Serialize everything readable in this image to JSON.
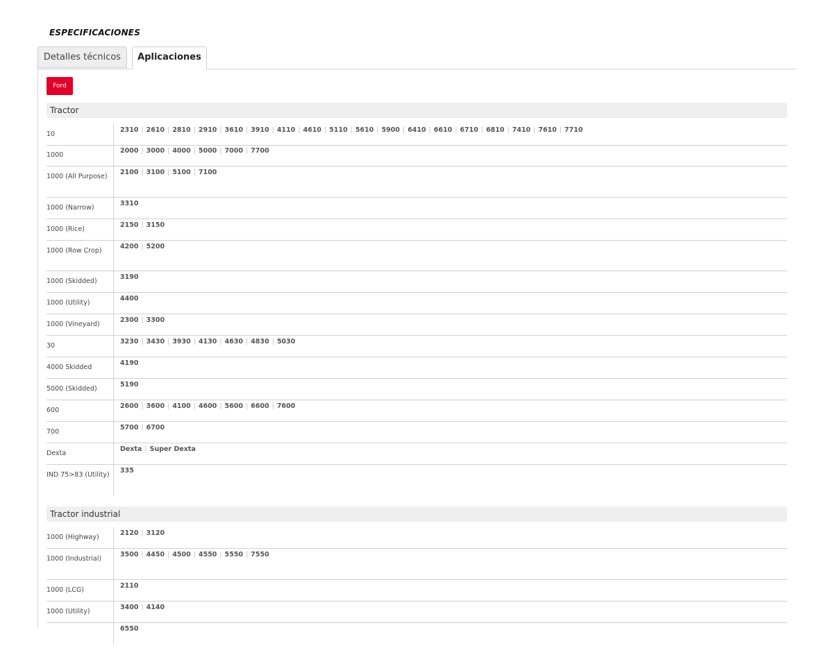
{
  "page": {
    "title": "ESPECIFICACIONES"
  },
  "tabs": [
    {
      "label": "Detalles técnicos",
      "active": false
    },
    {
      "label": "Aplicaciones",
      "active": true
    }
  ],
  "brand": {
    "label": "Ford",
    "color": "#e0002a"
  },
  "sections": [
    {
      "title": "Tractor",
      "rows": [
        {
          "label": "10",
          "models": [
            "2310",
            "2610",
            "2810",
            "2910",
            "3610",
            "3910",
            "4110",
            "4610",
            "5110",
            "5610",
            "5900",
            "6410",
            "6610",
            "6710",
            "6810",
            "7410",
            "7610",
            "7710"
          ]
        },
        {
          "label": "1000",
          "models": [
            "2000",
            "3000",
            "4000",
            "5000",
            "7000",
            "7700"
          ]
        },
        {
          "label": "1000 (All Purpose)",
          "models": [
            "2100",
            "3100",
            "5100",
            "7100"
          ]
        },
        {
          "label": "1000 (Narrow)",
          "models": [
            "3310"
          ]
        },
        {
          "label": "1000 (Rice)",
          "models": [
            "2150",
            "3150"
          ]
        },
        {
          "label": "1000 (Row Crop)",
          "models": [
            "4200",
            "5200"
          ]
        },
        {
          "label": "1000 (Skidded)",
          "models": [
            "3190"
          ]
        },
        {
          "label": "1000 (Utility)",
          "models": [
            "4400"
          ]
        },
        {
          "label": "1000 (Vineyard)",
          "models": [
            "2300",
            "3300"
          ]
        },
        {
          "label": "30",
          "models": [
            "3230",
            "3430",
            "3930",
            "4130",
            "4630",
            "4830",
            "5030"
          ]
        },
        {
          "label": "4000 Skidded",
          "models": [
            "4190"
          ]
        },
        {
          "label": "5000 (Skidded)",
          "models": [
            "5190"
          ]
        },
        {
          "label": "600",
          "models": [
            "2600",
            "3600",
            "4100",
            "4600",
            "5600",
            "6600",
            "7600"
          ]
        },
        {
          "label": "700",
          "models": [
            "5700",
            "6700"
          ]
        },
        {
          "label": "Dexta",
          "models": [
            "Dexta",
            "Super Dexta"
          ]
        },
        {
          "label": "IND 75>83 (Utility)",
          "models": [
            "335"
          ]
        }
      ]
    },
    {
      "title": "Tractor industrial",
      "rows": [
        {
          "label": "1000 (Highway)",
          "models": [
            "2120",
            "3120"
          ]
        },
        {
          "label": "1000 (Industrial)",
          "models": [
            "3500",
            "4450",
            "4500",
            "4550",
            "5550",
            "7550"
          ]
        },
        {
          "label": "1000 (LCG)",
          "models": [
            "2110"
          ]
        },
        {
          "label": "1000 (Utility)",
          "models": [
            "3400",
            "4140"
          ]
        },
        {
          "label": "",
          "models": [
            "6550"
          ]
        }
      ]
    }
  ]
}
